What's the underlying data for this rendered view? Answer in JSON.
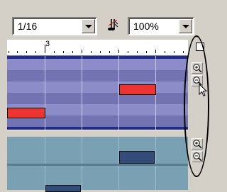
{
  "toolbar": {
    "quantize_value": "1/16",
    "zoom_value": "100%",
    "quantize_icon": "quantize-note-icon"
  },
  "ruler": {
    "bar_label": "3"
  },
  "zoom_controls": {
    "zoom_in_icon": "zoom-in-icon",
    "zoom_out_icon": "zoom-out-icon"
  },
  "colors": {
    "note_red": "#ee3333",
    "controller_bar": "#334c7a",
    "piano_roll_bg": "#8c8cc8",
    "controller_bg": "#7aa0b4"
  }
}
